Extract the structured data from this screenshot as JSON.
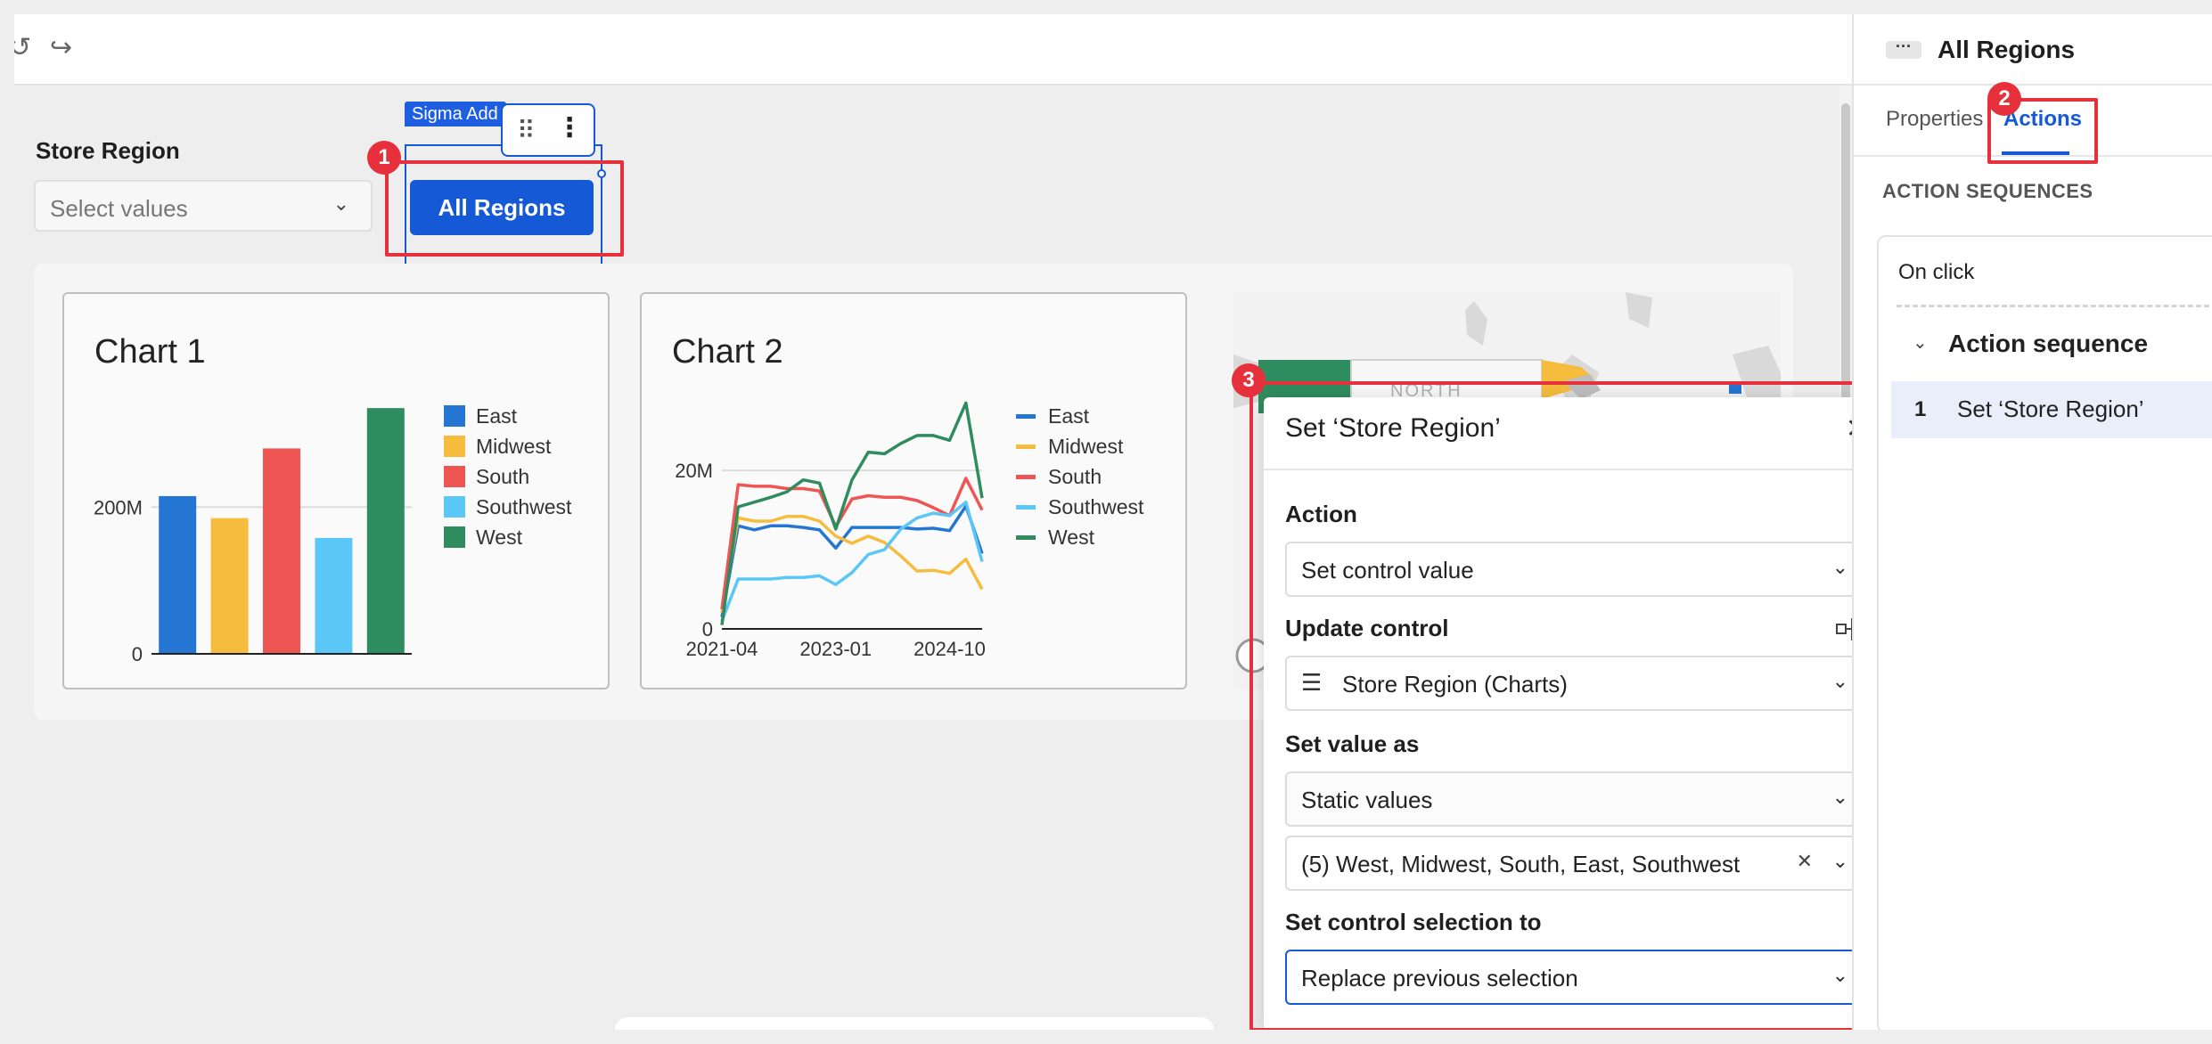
{
  "toolbar": {
    "undo_icon": "undo-icon",
    "redo_icon": "redo-icon"
  },
  "control": {
    "label": "Store Region",
    "placeholder": "Select values"
  },
  "button": {
    "element_tag": "Sigma Add",
    "label": "All Regions"
  },
  "annotations": {
    "one": "1",
    "two": "2",
    "three": "3",
    "color": "#e6303c"
  },
  "chart1": {
    "title": "Chart 1"
  },
  "chart2": {
    "title": "Chart 2"
  },
  "chart_data": [
    {
      "type": "bar",
      "title": "Chart 1",
      "categories": [
        "East",
        "Midwest",
        "South",
        "Southwest",
        "West"
      ],
      "values": [
        215,
        185,
        280,
        158,
        335
      ],
      "colors": [
        "#2476d2",
        "#f5bc3d",
        "#ef5552",
        "#5bc7f7",
        "#2f8c5e"
      ],
      "yticks": [
        {
          "value": 0,
          "label": "0"
        },
        {
          "value": 200,
          "label": "200M"
        }
      ],
      "ylim": [
        0,
        340
      ],
      "legend": [
        "East",
        "Midwest",
        "South",
        "Southwest",
        "West"
      ],
      "legend_position": "right"
    },
    {
      "type": "line",
      "title": "Chart 2",
      "x": [
        "2021-04",
        "2021-07",
        "2021-10",
        "2022-01",
        "2022-04",
        "2022-07",
        "2022-10",
        "2023-01",
        "2023-04",
        "2023-07",
        "2023-10",
        "2024-01",
        "2024-04",
        "2024-07",
        "2024-10",
        "2025-01",
        "2025-04"
      ],
      "xticks": [
        "2021-04",
        "2023-01",
        "2024-10"
      ],
      "yticks": [
        {
          "value": 0,
          "label": "0"
        },
        {
          "value": 20,
          "label": "20M"
        }
      ],
      "ylim": [
        0,
        29
      ],
      "legend_position": "right",
      "series": [
        {
          "name": "East",
          "color": "#2476d2",
          "values": [
            1.5,
            13.0,
            12.5,
            13.0,
            13.0,
            12.8,
            12.5,
            10.2,
            12.8,
            12.8,
            12.8,
            12.8,
            12.6,
            12.7,
            12.4,
            15.5,
            9.5
          ]
        },
        {
          "name": "Midwest",
          "color": "#f5bc3d",
          "values": [
            2.0,
            14.0,
            13.6,
            13.6,
            14.2,
            14.2,
            13.6,
            11.7,
            10.8,
            11.7,
            10.9,
            9.2,
            7.3,
            7.4,
            7.0,
            8.8,
            5.0
          ]
        },
        {
          "name": "South",
          "color": "#ef5552",
          "values": [
            2.5,
            18.2,
            18.0,
            18.0,
            17.7,
            17.7,
            17.4,
            12.9,
            16.4,
            16.8,
            16.6,
            16.6,
            16.2,
            15.3,
            14.3,
            19.0,
            15.0
          ]
        },
        {
          "name": "Southwest",
          "color": "#5bc7f7",
          "values": [
            1.0,
            6.3,
            6.3,
            6.3,
            6.5,
            6.5,
            6.7,
            5.6,
            7.1,
            9.4,
            10.0,
            12.6,
            14.0,
            14.6,
            14.3,
            16.0,
            8.5
          ]
        },
        {
          "name": "West",
          "color": "#2f8c5e",
          "values": [
            0.5,
            15.4,
            16.0,
            16.6,
            17.3,
            18.8,
            18.4,
            12.6,
            18.8,
            22.3,
            22.1,
            23.4,
            24.4,
            24.4,
            23.8,
            28.5,
            16.5
          ]
        }
      ]
    }
  ],
  "modal": {
    "title": "Set ‘Store Region’",
    "action_label": "Action",
    "action_value": "Set control value",
    "update_label": "Update control",
    "update_value": "Store Region (Charts)",
    "setvalue_label": "Set value as",
    "setvalue_value": "Static values",
    "values_value": "(5) West, Midwest, South, East, Southwest",
    "selection_label": "Set control selection to",
    "selection_value": "Replace previous selection"
  },
  "sidebar": {
    "title": "All Regions",
    "tab_properties": "Properties",
    "tab_actions": "Actions",
    "section_title": "ACTION SEQUENCES",
    "trigger": "On click",
    "sequence_name": "Action sequence",
    "item_number": "1",
    "item_label": "Set ‘Store Region’"
  },
  "map": {
    "partial_label": "NORTH"
  }
}
